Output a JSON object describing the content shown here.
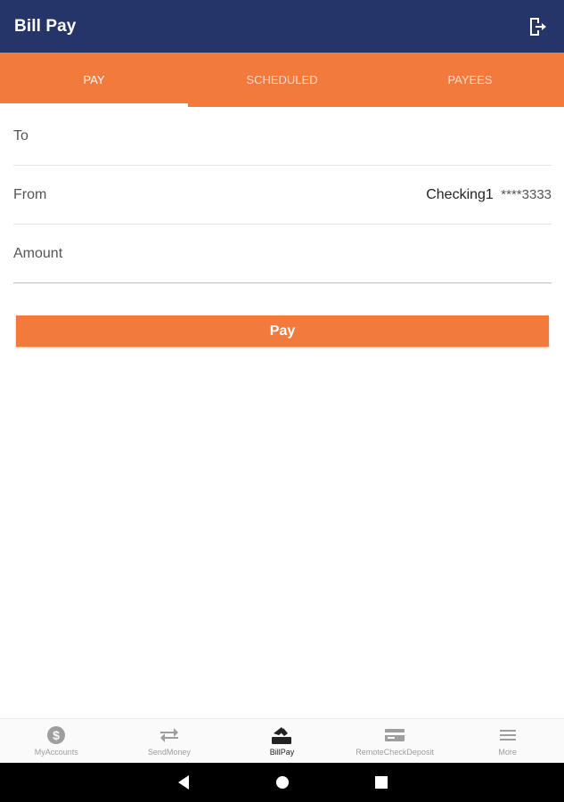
{
  "app": {
    "title": "Bill Pay",
    "header_bg": "#253569",
    "accent": "#f27a3d"
  },
  "tabs": [
    {
      "label": "PAY",
      "active": true
    },
    {
      "label": "SCHEDULED",
      "active": false
    },
    {
      "label": "PAYEES",
      "active": false
    }
  ],
  "form": {
    "to_label": "To",
    "from_label": "From",
    "from_account_name": "Checking1",
    "from_account_mask": "****3333",
    "amount_label": "Amount"
  },
  "pay_button_label": "Pay",
  "bottom_nav": [
    {
      "label": "MyAccounts",
      "icon": "dollar-coin-icon",
      "active": false
    },
    {
      "label": "SendMoney",
      "icon": "transfer-arrows-icon",
      "active": false
    },
    {
      "label": "BillPay",
      "icon": "bill-pay-icon",
      "active": true
    },
    {
      "label": "RemoteCheckDeposit",
      "icon": "check-card-icon",
      "active": false
    },
    {
      "label": "More",
      "icon": "menu-icon",
      "active": false
    }
  ],
  "system_nav": [
    "back-icon",
    "home-icon",
    "recents-icon"
  ]
}
